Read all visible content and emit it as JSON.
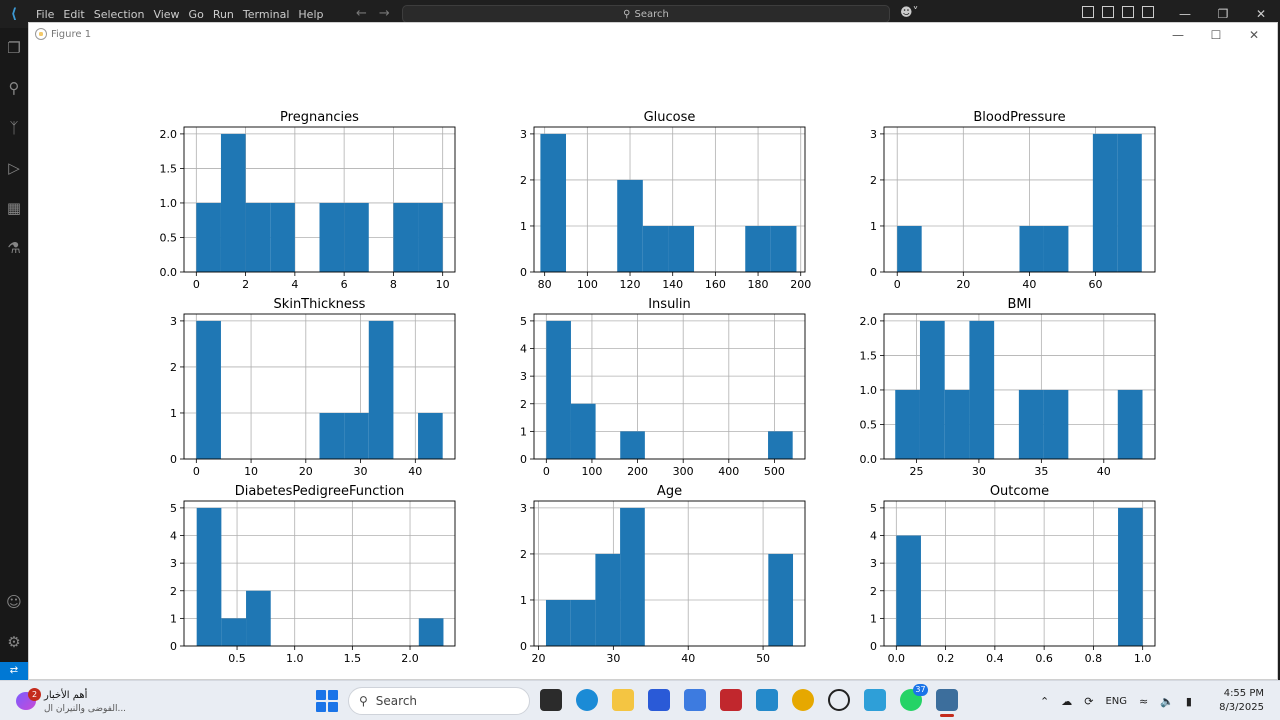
{
  "vscode": {
    "menu": [
      "File",
      "Edit",
      "Selection",
      "View",
      "Go",
      "Run",
      "Terminal",
      "Help"
    ],
    "search_label": "Search"
  },
  "figure_window": {
    "title": "Figure 1"
  },
  "chart_data": [
    {
      "type": "bar",
      "title": "Pregnancies",
      "xlabel": "",
      "ylabel": "",
      "grid": true,
      "xlim": [
        -0.5,
        10.5
      ],
      "ylim": [
        0,
        2.1
      ],
      "xticks": [
        0,
        2,
        4,
        6,
        8,
        10
      ],
      "xtick_labels": [
        "0",
        "2",
        "4",
        "6",
        "8",
        "10"
      ],
      "yticks": [
        0.0,
        0.5,
        1.0,
        1.5,
        2.0
      ],
      "ytick_labels": [
        "0.0",
        "0.5",
        "1.0",
        "1.5",
        "2.0"
      ],
      "bin_edges": [
        0,
        1,
        2,
        3,
        4,
        5,
        6,
        7,
        8,
        9,
        10
      ],
      "counts": [
        1,
        2,
        1,
        1,
        0,
        1,
        1,
        0,
        1,
        1
      ]
    },
    {
      "type": "bar",
      "title": "Glucose",
      "xlabel": "",
      "ylabel": "",
      "grid": true,
      "xlim": [
        75,
        202
      ],
      "ylim": [
        0,
        3.15
      ],
      "xticks": [
        80,
        100,
        120,
        140,
        160,
        180,
        200
      ],
      "xtick_labels": [
        "80",
        "100",
        "120",
        "140",
        "160",
        "180",
        "200"
      ],
      "yticks": [
        0,
        1,
        2,
        3
      ],
      "ytick_labels": [
        "0",
        "1",
        "2",
        "3"
      ],
      "bin_edges": [
        78,
        90,
        102,
        114,
        126,
        138,
        150,
        162,
        174,
        186,
        198
      ],
      "counts": [
        3,
        0,
        0,
        2,
        1,
        1,
        0,
        0,
        1,
        1
      ]
    },
    {
      "type": "bar",
      "title": "BloodPressure",
      "xlabel": "",
      "ylabel": "",
      "grid": true,
      "xlim": [
        -4,
        78
      ],
      "ylim": [
        0,
        3.15
      ],
      "xticks": [
        0,
        20,
        40,
        60
      ],
      "xtick_labels": [
        "0",
        "20",
        "40",
        "60"
      ],
      "yticks": [
        0,
        1,
        2,
        3
      ],
      "ytick_labels": [
        "0",
        "1",
        "2",
        "3"
      ],
      "bin_edges": [
        0,
        7.4,
        14.8,
        22.2,
        29.6,
        37,
        44.4,
        51.8,
        59.2,
        66.6,
        74
      ],
      "counts": [
        1,
        0,
        0,
        0,
        0,
        1,
        1,
        0,
        3,
        3
      ]
    },
    {
      "type": "bar",
      "title": "SkinThickness",
      "xlabel": "",
      "ylabel": "",
      "grid": true,
      "xlim": [
        -2.25,
        47.25
      ],
      "ylim": [
        0,
        3.15
      ],
      "xticks": [
        0,
        10,
        20,
        30,
        40
      ],
      "xtick_labels": [
        "0",
        "10",
        "20",
        "30",
        "40"
      ],
      "yticks": [
        0,
        1,
        2,
        3
      ],
      "ytick_labels": [
        "0",
        "1",
        "2",
        "3"
      ],
      "bin_edges": [
        0,
        4.5,
        9,
        13.5,
        18,
        22.5,
        27,
        31.5,
        36,
        40.5,
        45
      ],
      "counts": [
        3,
        0,
        0,
        0,
        0,
        1,
        1,
        3,
        0,
        1
      ]
    },
    {
      "type": "bar",
      "title": "Insulin",
      "xlabel": "",
      "ylabel": "",
      "grid": true,
      "xlim": [
        -27,
        567
      ],
      "ylim": [
        0,
        5.25
      ],
      "xticks": [
        0,
        100,
        200,
        300,
        400,
        500
      ],
      "xtick_labels": [
        "0",
        "100",
        "200",
        "300",
        "400",
        "500"
      ],
      "yticks": [
        0,
        1,
        2,
        3,
        4,
        5
      ],
      "ytick_labels": [
        "0",
        "1",
        "2",
        "3",
        "4",
        "5"
      ],
      "bin_edges": [
        0,
        54,
        108,
        162,
        216,
        270,
        324,
        378,
        432,
        486,
        540
      ],
      "counts": [
        5,
        2,
        0,
        1,
        0,
        0,
        0,
        0,
        0,
        1
      ]
    },
    {
      "type": "bar",
      "title": "BMI",
      "xlabel": "",
      "ylabel": "",
      "grid": true,
      "xlim": [
        22.4,
        44.1
      ],
      "ylim": [
        0,
        2.1
      ],
      "xticks": [
        25,
        30,
        35,
        40
      ],
      "xtick_labels": [
        "25",
        "30",
        "35",
        "40"
      ],
      "yticks": [
        0.0,
        0.5,
        1.0,
        1.5,
        2.0
      ],
      "ytick_labels": [
        "0.0",
        "0.5",
        "1.0",
        "1.5",
        "2.0"
      ],
      "bin_edges": [
        23.3,
        25.28,
        27.26,
        29.24,
        31.22,
        33.2,
        35.18,
        37.16,
        39.14,
        41.12,
        43.1
      ],
      "counts": [
        1,
        2,
        1,
        2,
        0,
        1,
        1,
        0,
        0,
        1
      ]
    },
    {
      "type": "bar",
      "title": "DiabetesPedigreeFunction",
      "xlabel": "",
      "ylabel": "",
      "grid": true,
      "xlim": [
        0.04,
        2.39
      ],
      "ylim": [
        0,
        5.25
      ],
      "xticks": [
        0.5,
        1.0,
        1.5,
        2.0
      ],
      "xtick_labels": [
        "0.5",
        "1.0",
        "1.5",
        "2.0"
      ],
      "yticks": [
        0,
        1,
        2,
        3,
        4,
        5
      ],
      "ytick_labels": [
        "0",
        "1",
        "2",
        "3",
        "4",
        "5"
      ],
      "bin_edges": [
        0.15,
        0.364,
        0.578,
        0.792,
        1.006,
        1.22,
        1.434,
        1.648,
        1.862,
        2.076,
        2.29
      ],
      "counts": [
        5,
        1,
        2,
        0,
        0,
        0,
        0,
        0,
        0,
        1
      ]
    },
    {
      "type": "bar",
      "title": "Age",
      "xlabel": "",
      "ylabel": "",
      "grid": true,
      "xlim": [
        19.4,
        55.6
      ],
      "ylim": [
        0,
        3.15
      ],
      "xticks": [
        20,
        30,
        40,
        50
      ],
      "xtick_labels": [
        "20",
        "30",
        "40",
        "50"
      ],
      "yticks": [
        0,
        1,
        2,
        3
      ],
      "ytick_labels": [
        "0",
        "1",
        "2",
        "3"
      ],
      "bin_edges": [
        21,
        24.3,
        27.6,
        30.9,
        34.2,
        37.5,
        40.8,
        44.1,
        47.4,
        50.7,
        54
      ],
      "counts": [
        1,
        1,
        2,
        3,
        0,
        0,
        0,
        0,
        0,
        2
      ]
    },
    {
      "type": "bar",
      "title": "Outcome",
      "xlabel": "",
      "ylabel": "",
      "grid": true,
      "xlim": [
        -0.05,
        1.05
      ],
      "ylim": [
        0,
        5.25
      ],
      "xticks": [
        0.0,
        0.2,
        0.4,
        0.6,
        0.8,
        1.0
      ],
      "xtick_labels": [
        "0.0",
        "0.2",
        "0.4",
        "0.6",
        "0.8",
        "1.0"
      ],
      "yticks": [
        0,
        1,
        2,
        3,
        4,
        5
      ],
      "ytick_labels": [
        "0",
        "1",
        "2",
        "3",
        "4",
        "5"
      ],
      "bin_edges": [
        0,
        0.1,
        0.2,
        0.3,
        0.4,
        0.5,
        0.6,
        0.7,
        0.8,
        0.9,
        1.0
      ],
      "counts": [
        4,
        0,
        0,
        0,
        0,
        0,
        0,
        0,
        0,
        5
      ]
    }
  ],
  "colors": {
    "bar": "#1f77b4",
    "grid": "#b0b0b0",
    "vscode_accent": "#0078d4"
  },
  "taskbar": {
    "news_title": "أهم الأخبار",
    "news_subtitle": "الفوضى والنيران ال...",
    "news_badge": "2",
    "search_label": "Search",
    "whatsapp_badge": "37",
    "language": "ENG",
    "time": "4:55 PM",
    "date": "8/3/2025"
  }
}
